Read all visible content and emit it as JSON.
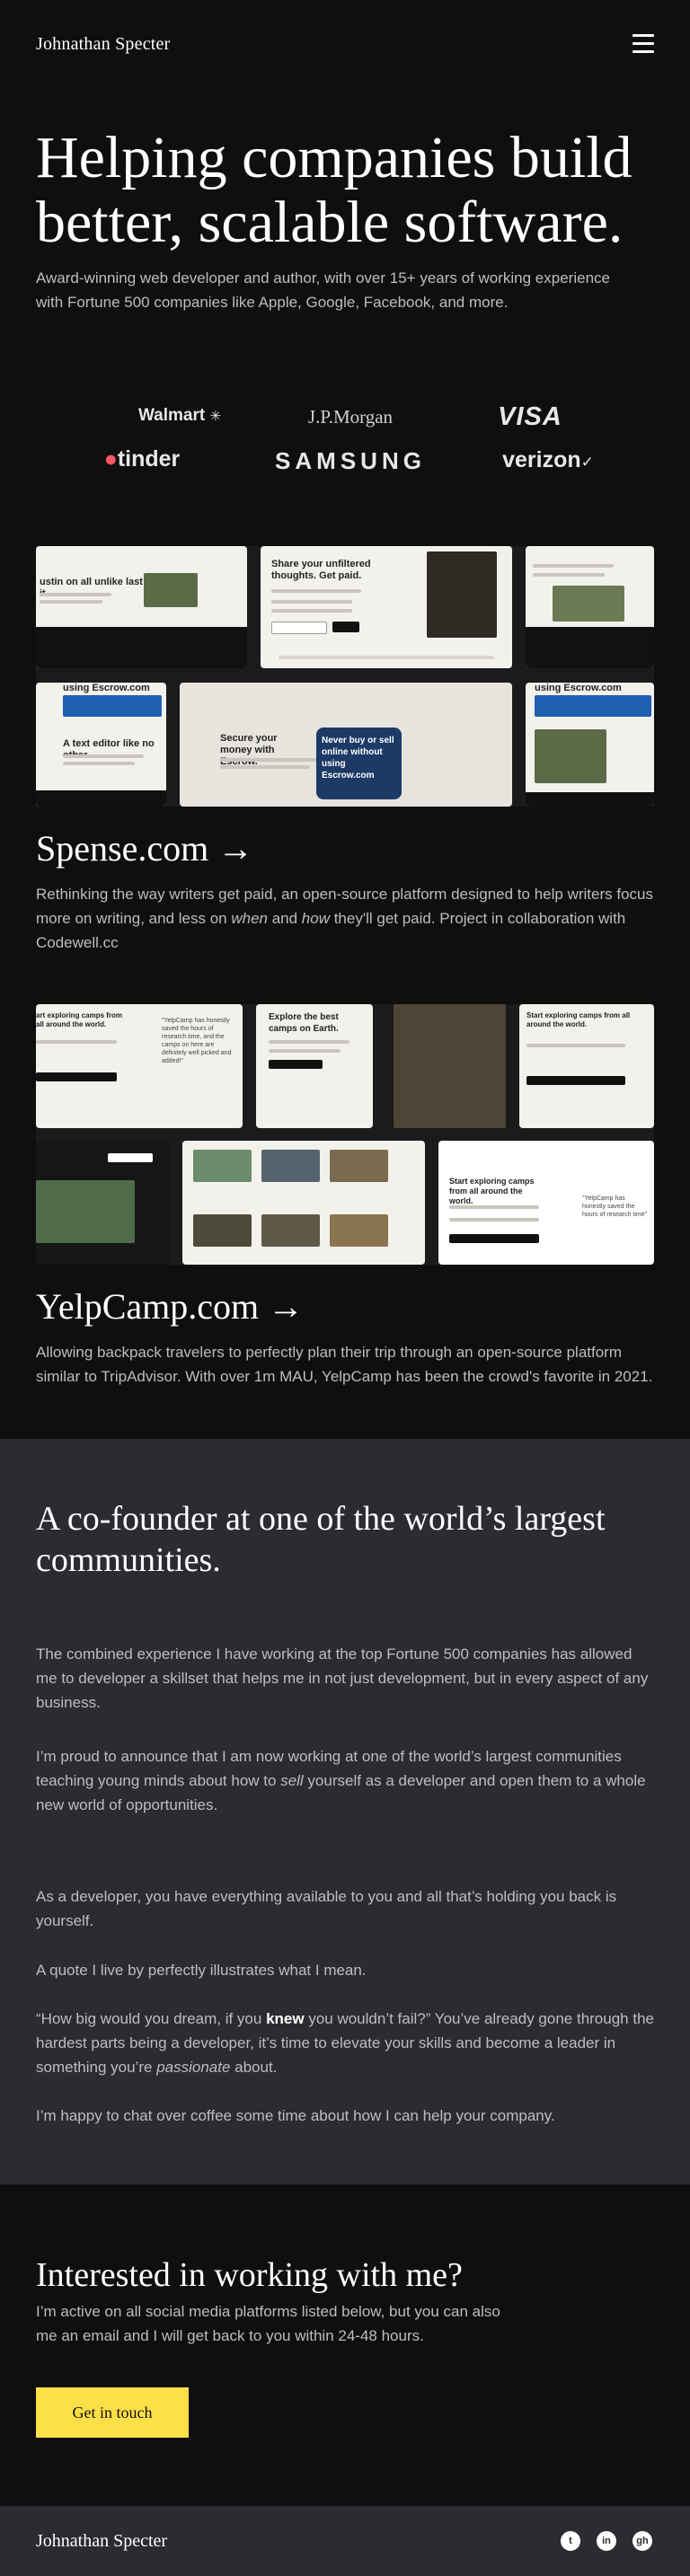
{
  "header": {
    "brand": "Johnathan Specter",
    "menu_icon": "hamburger-menu-icon"
  },
  "hero": {
    "title": "Helping companies build better, scalable software.",
    "subtitle": "Award-winning web developer and author, with over 15+ years of working experience with Fortune 500 companies like Apple, Google, Facebook, and more."
  },
  "logos": [
    "Walmart",
    "J.P.Morgan",
    "VISA",
    "tinder",
    "SAMSUNG",
    "verizon"
  ],
  "projects": [
    {
      "title": "Spense.com →",
      "description_parts": [
        "Rethinking the way writers get paid, an open-source platform designed to help writers focus more on writing, and less on ",
        "when",
        " and ",
        "how",
        " they'll get paid. Project in collaboration with Codewell.cc"
      ],
      "mock": {
        "hero_title": "Share your unfiltered thoughts. Get paid.",
        "tile_a": "A text editor like no other.",
        "tile_b": "Secure your money with Escrow.",
        "tile_c": "Never buy or sell online without using Escrow.com",
        "tile_d": "using Escrow.com",
        "tile_e": "A text editor like no other.",
        "tile_f": "ustin on all unlike last it",
        "tile_g": "using Escrow.com"
      }
    },
    {
      "title": "YelpCamp.com →",
      "description": "Allowing backpack travelers to perfectly plan their trip through an open-source platform similar to TripAdvisor. With over 1m MAU, YelpCamp has been the crowd's favorite in 2021.",
      "mock": {
        "tile_a": "art exploring camps from all around the world.",
        "tile_b": "\"YelpCamp has honestly saved the hours of research time, and the camps on here are definitely well picked and added!\"",
        "tile_c": "Explore the best camps on Earth.",
        "tile_d": "Start exploring camps from all around the world.",
        "tile_e": "Start exploring camps from all around the world.",
        "tile_f": "\"YelpCamp has honestly saved the hours of research time\""
      }
    }
  ],
  "cofounder": {
    "title": "A co-founder at one of the world’s largest communities.",
    "p1": "The combined experience I have working at the top Fortune 500 companies has allowed me to developer a skillset that helps me in not just development, but in every aspect of any business.",
    "p2_parts": [
      "I’m proud to announce that I am now working at one of the world’s largest communities teaching young minds about how to ",
      "sell",
      " yourself as a developer and open them to a whole new world of opportunities."
    ],
    "p3": "As a developer, you have everything available to you and all that’s holding you back is yourself.",
    "p4": "A quote I live by perfectly illustrates what I mean.",
    "p5_parts": [
      "“How big would you dream, if you ",
      "knew",
      " you wouldn’t fail?” You’ve already gone through the hardest parts being a developer, it’s time to elevate your skills and become a leader in something you’re ",
      "passionate",
      " about."
    ],
    "p6": "I’m happy to chat over coffee some time about how I can help your company."
  },
  "cta": {
    "title": "Interested in working with me?",
    "text": "I’m active on all social media platforms listed below, but you can also me an email and I will get back to you within 24-48 hours.",
    "button": "Get in touch"
  },
  "footer": {
    "brand": "Johnathan Specter",
    "social": [
      {
        "icon": "twitter-icon",
        "glyph": "t"
      },
      {
        "icon": "linkedin-icon",
        "glyph": "in"
      },
      {
        "icon": "github-icon",
        "glyph": "gh"
      }
    ]
  },
  "colors": {
    "background": "#0f0f10",
    "section": "#2a2c31",
    "accent": "#fde047",
    "muted_text": "#bdbdc2"
  }
}
